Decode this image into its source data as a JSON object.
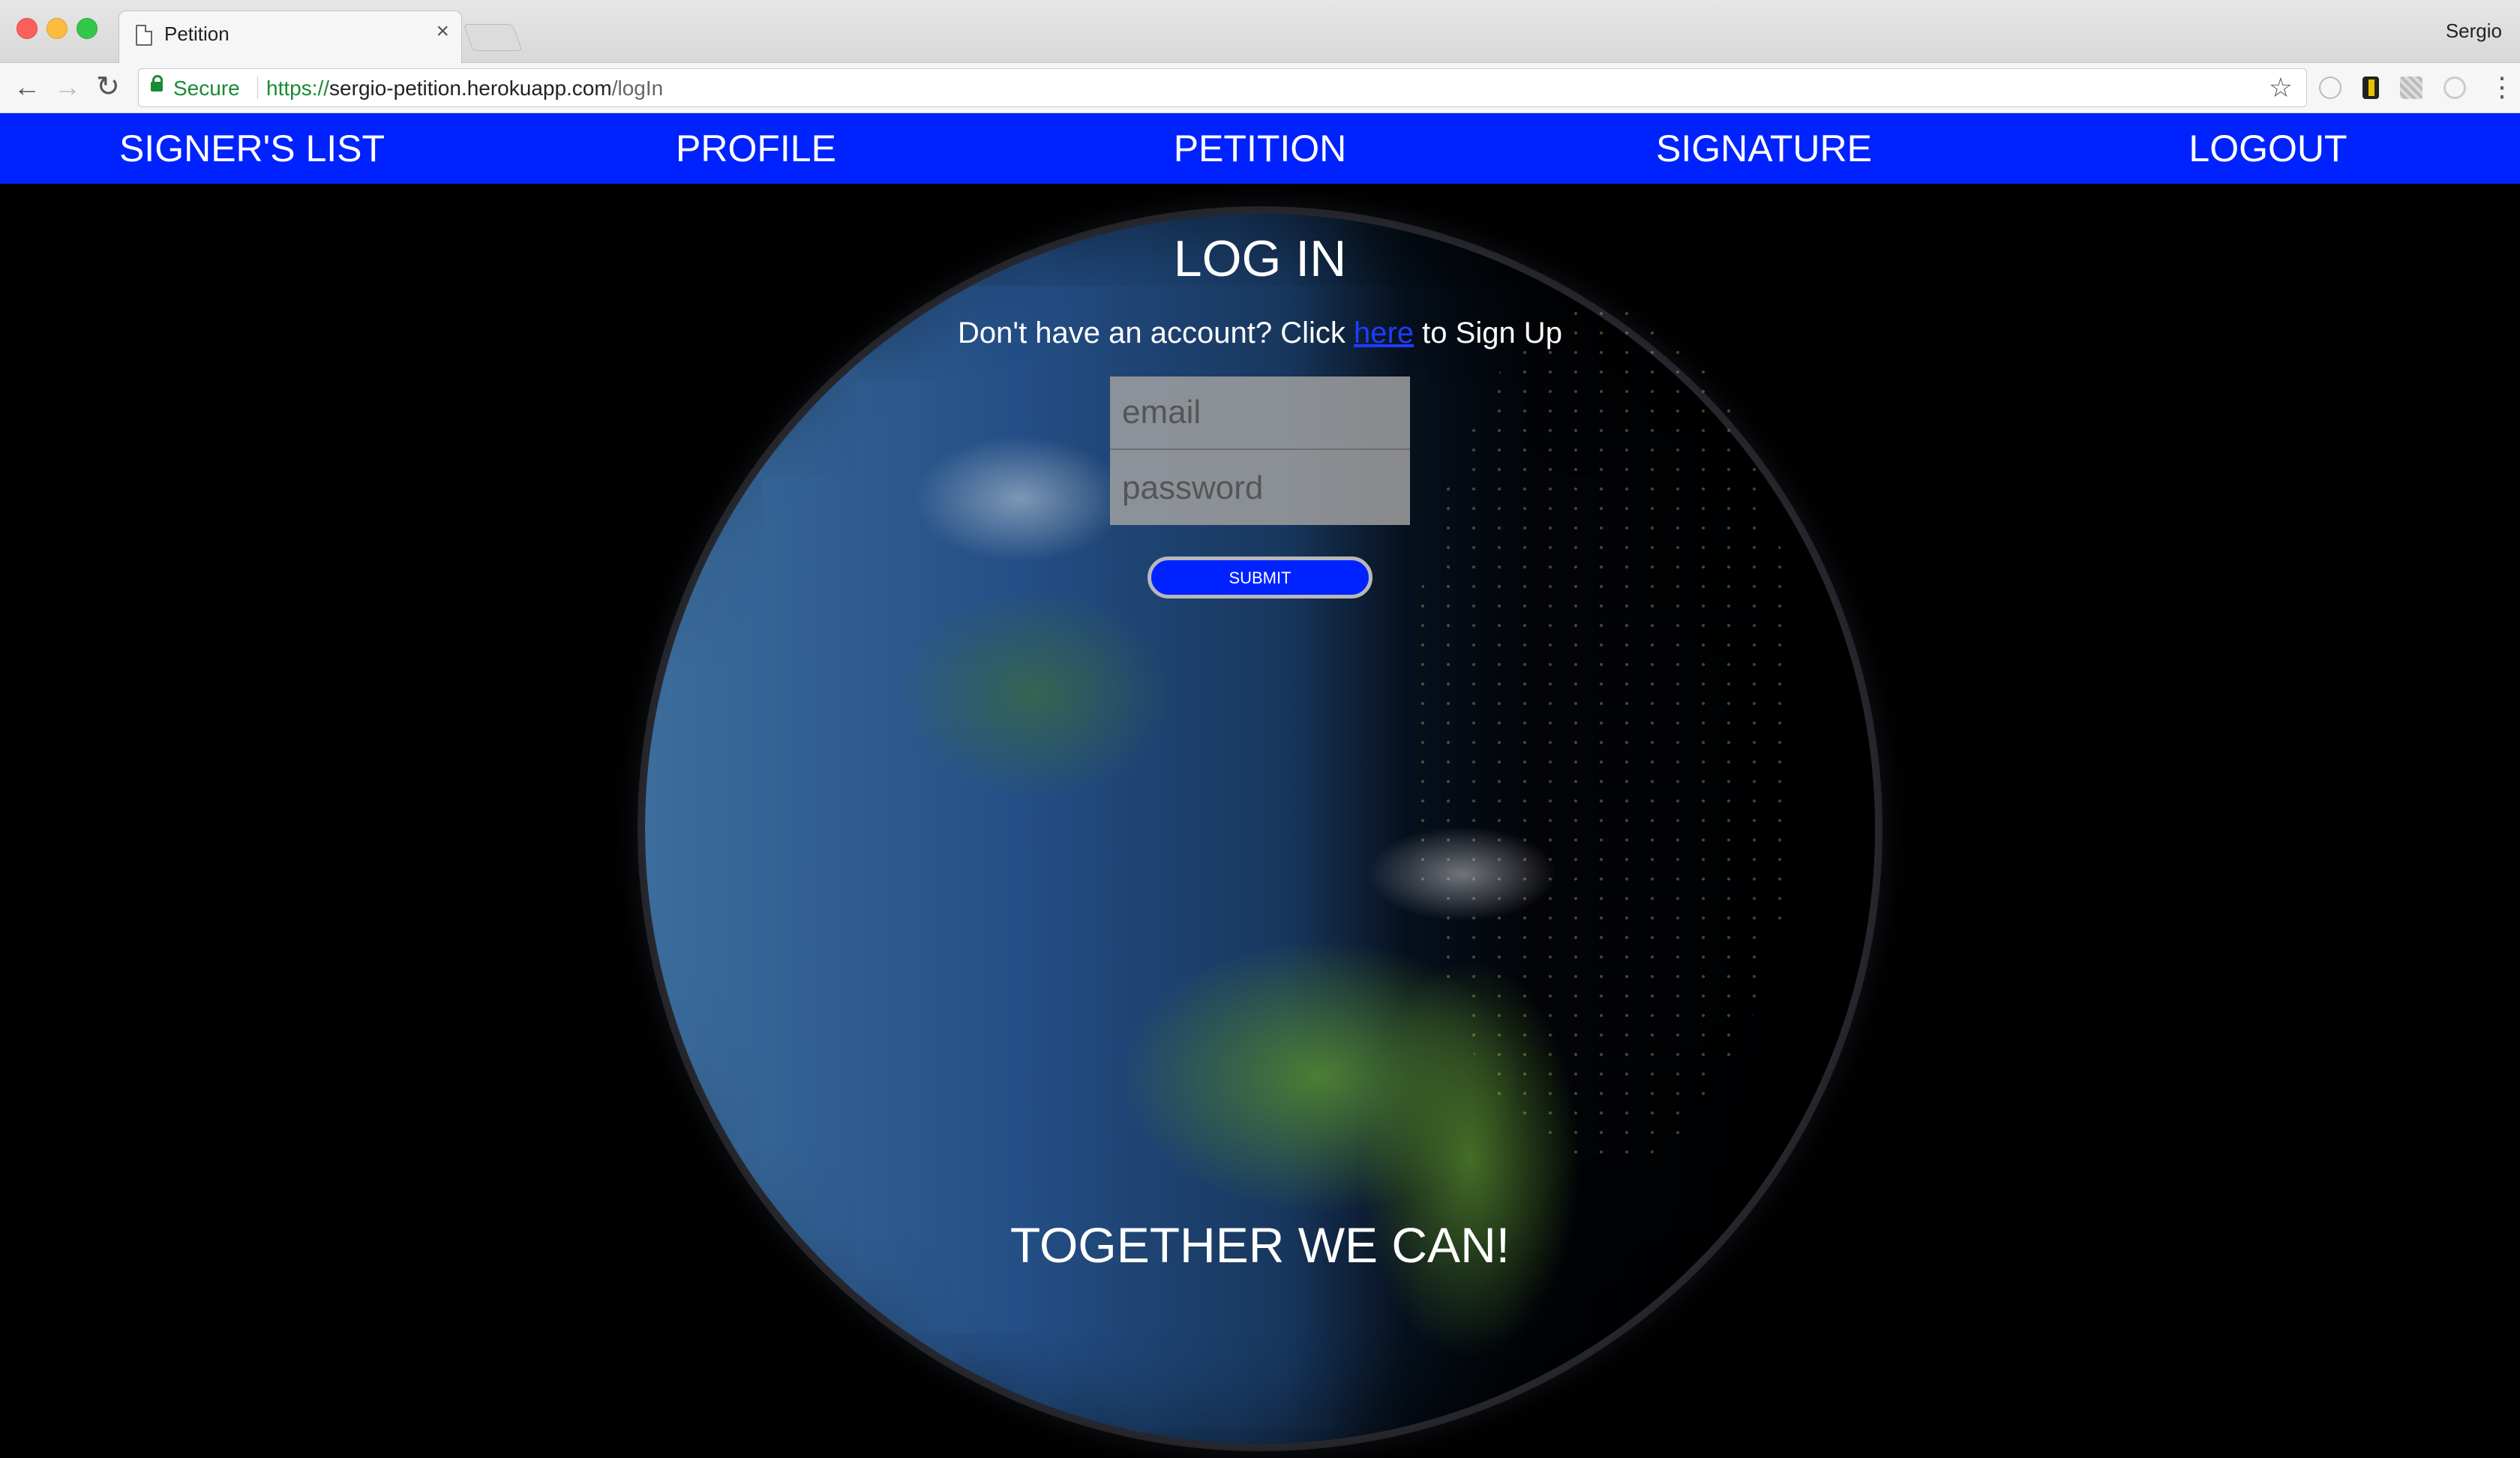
{
  "browser": {
    "tab_title": "Petition",
    "tab_close": "×",
    "profile_name": "Sergio",
    "secure_label": "Secure",
    "url_proto": "https://",
    "url_host": "sergio-petition.herokuapp.com",
    "url_path": "/logIn"
  },
  "nav": {
    "items": [
      {
        "label": "SIGNER'S LIST"
      },
      {
        "label": "PROFILE"
      },
      {
        "label": "PETITION"
      },
      {
        "label": "SIGNATURE"
      },
      {
        "label": "LOGOUT"
      }
    ],
    "color": "#0022ff"
  },
  "login": {
    "title": "LOG IN",
    "signup_prefix": "Don't have an account? Click ",
    "signup_link": "here",
    "signup_suffix": " to Sign Up",
    "email_placeholder": "email",
    "password_placeholder": "password",
    "submit_label": "SUBMIT"
  },
  "tagline": "TOGETHER WE CAN!",
  "colors": {
    "accent": "#0022ff",
    "background": "#000000",
    "secure_green": "#1a8a33"
  }
}
